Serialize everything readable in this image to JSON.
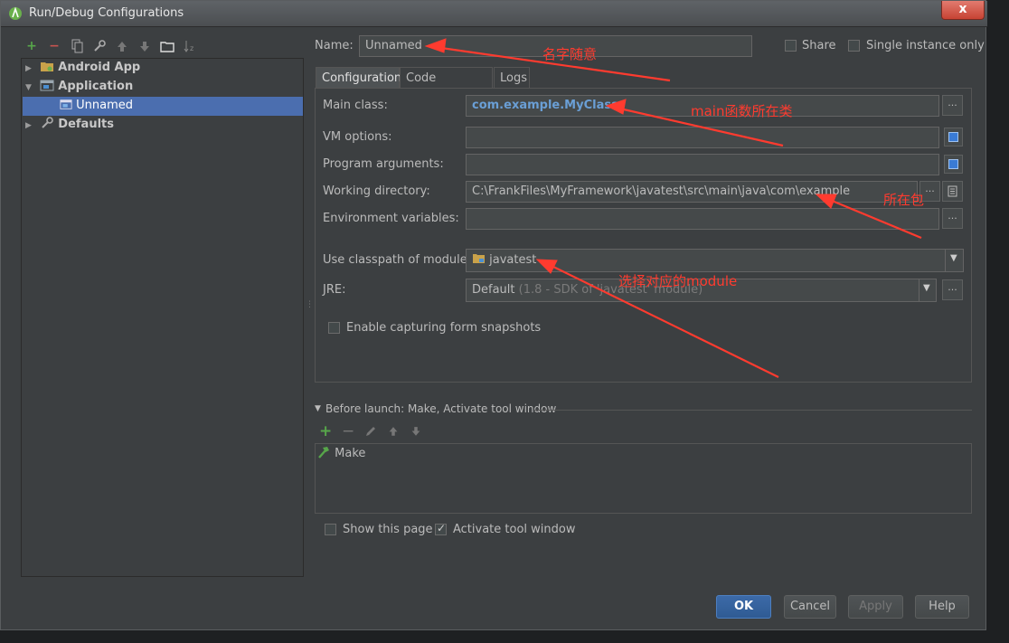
{
  "window": {
    "title": "Run/Debug Configurations",
    "close_glyph": "x"
  },
  "left_toolbar": {
    "icons": [
      "add-icon",
      "remove-icon",
      "copy-icon",
      "wrench-icon",
      "move-up-icon",
      "move-down-icon",
      "folder-icon",
      "sort-icon"
    ]
  },
  "tree": {
    "items": [
      {
        "label": "Android App",
        "expanded": false
      },
      {
        "label": "Application",
        "expanded": true
      },
      {
        "label": "Unnamed",
        "selected": true
      },
      {
        "label": "Defaults",
        "expanded": false
      }
    ]
  },
  "name_row": {
    "label": "Name:",
    "value": "Unnamed"
  },
  "share": {
    "label": "Share",
    "checked": false
  },
  "single_instance": {
    "label": "Single instance only",
    "checked": false
  },
  "tabs": [
    {
      "label": "Configuration",
      "active": true
    },
    {
      "label": "Code Coverage",
      "active": false
    },
    {
      "label": "Logs",
      "active": false
    }
  ],
  "config": {
    "main_class": {
      "label": "Main class:",
      "value": "com.example.MyClass"
    },
    "vm_options": {
      "label": "VM options:",
      "value": ""
    },
    "program_arguments": {
      "label": "Program arguments:",
      "value": ""
    },
    "working_directory": {
      "label": "Working directory:",
      "value": "C:\\FrankFiles\\MyFramework\\javatest\\src\\main\\java\\com\\example"
    },
    "environment_variables": {
      "label": "Environment variables:",
      "value": ""
    },
    "classpath_module": {
      "label": "Use classpath of module:",
      "value": "javatest"
    },
    "jre": {
      "label": "JRE:",
      "value": "Default",
      "hint": "(1.8 - SDK of 'javatest' module)"
    },
    "capture_snapshots": {
      "label": "Enable capturing form snapshots",
      "checked": false
    }
  },
  "before_launch": {
    "header": "Before launch: Make, Activate tool window",
    "items": [
      "Make"
    ]
  },
  "show_this_page": {
    "label": "Show this page",
    "checked": false
  },
  "activate_tool_window": {
    "label": "Activate tool window",
    "checked": true
  },
  "buttons": {
    "ok": "OK",
    "cancel": "Cancel",
    "apply": "Apply",
    "help": "Help"
  },
  "annotations": {
    "name_note": "名字随意",
    "main_note": "main函数所在类",
    "package_note": "所在包",
    "module_note": "选择对应的module"
  },
  "colors": {
    "annotation": "#ff3b2f",
    "selection": "#4b6eaf",
    "accent_button": "#3c6aa8"
  }
}
